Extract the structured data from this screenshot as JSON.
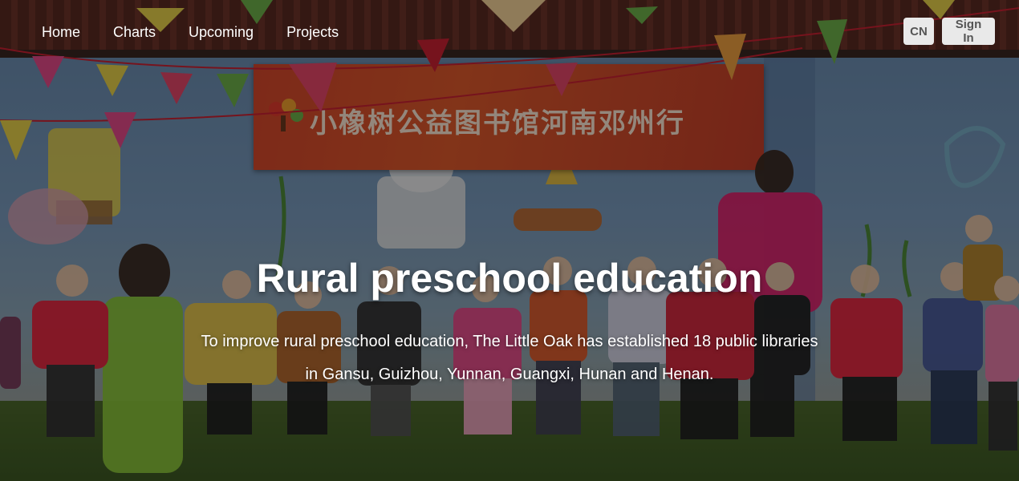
{
  "nav": {
    "links": [
      {
        "label": "Home"
      },
      {
        "label": "Charts"
      },
      {
        "label": "Upcoming"
      },
      {
        "label": "Projects"
      }
    ],
    "lang_button": "CN",
    "signin_button": "Sign In"
  },
  "background": {
    "banner_text": "小橡树公益图书馆河南邓州行",
    "banner_logo_text": "小橡树"
  },
  "hero": {
    "title": "Rural preschool education",
    "subtitle": "To improve rural preschool education, The Little Oak has established 18 public libraries in Gansu, Guizhou, Yunnan, Guangxi, Hunan and Henan."
  },
  "colors": {
    "banner_red": "#d8482c",
    "wall_blue": "#7a9bbd",
    "grass_green": "#4e6a2c",
    "button_bg": "#e9e9e9"
  }
}
